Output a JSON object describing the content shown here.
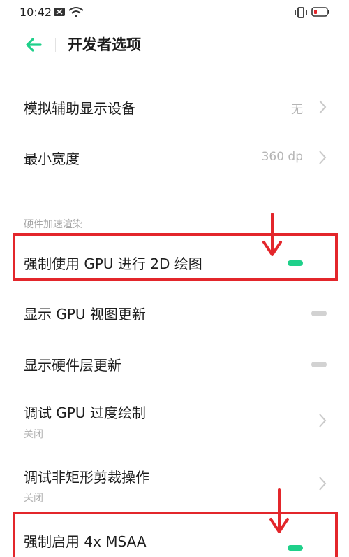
{
  "status_bar": {
    "time": "10:42"
  },
  "header": {
    "title": "开发者选项"
  },
  "rows": [
    {
      "label": "模拟辅助显示设备",
      "value": "无"
    },
    {
      "label": "最小宽度",
      "value": "360 dp"
    }
  ],
  "section": {
    "title": "硬件加速渲染"
  },
  "toggles": [
    {
      "label": "强制使用 GPU 进行 2D 绘图",
      "state": "on"
    },
    {
      "label": "显示 GPU 视图更新",
      "state": "off"
    },
    {
      "label": "显示硬件层更新",
      "state": "off"
    }
  ],
  "nav_rows": [
    {
      "label": "调试 GPU 过度绘制",
      "sub": "关闭"
    },
    {
      "label": "调试非矩形剪裁操作",
      "sub": "关闭"
    }
  ],
  "msaa": {
    "label": "强制启用 4x MSAA",
    "state": "on"
  },
  "colors": {
    "accent": "#1fd08a",
    "highlight": "#e3262b"
  }
}
